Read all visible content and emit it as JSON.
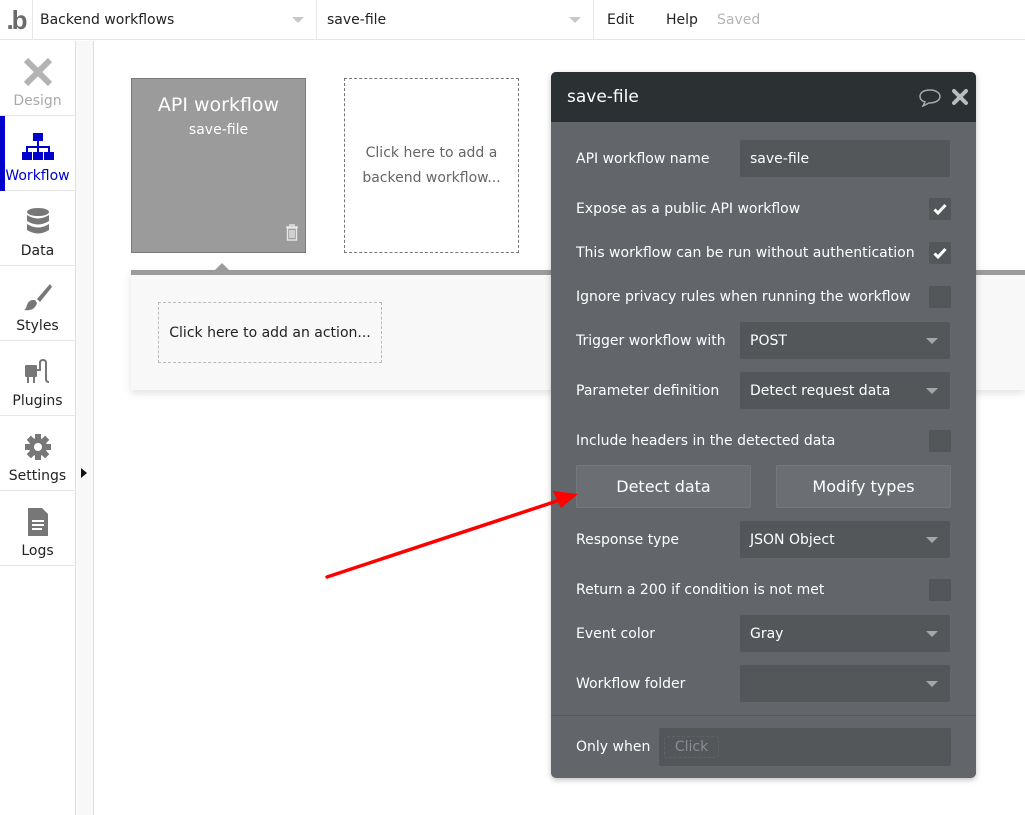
{
  "topbar": {
    "logo": ".b",
    "page_selector": "Backend workflows",
    "workflow_selector": "save-file",
    "menu_edit": "Edit",
    "menu_help": "Help",
    "save_status": "Saved"
  },
  "sidebar": {
    "items": [
      {
        "label": "Design",
        "icon": "design-icon",
        "state": "disabled"
      },
      {
        "label": "Workflow",
        "icon": "workflow-icon",
        "state": "active"
      },
      {
        "label": "Data",
        "icon": "database-icon",
        "state": "normal"
      },
      {
        "label": "Styles",
        "icon": "brush-icon",
        "state": "normal"
      },
      {
        "label": "Plugins",
        "icon": "plug-icon",
        "state": "normal"
      },
      {
        "label": "Settings",
        "icon": "gear-icon",
        "state": "normal"
      },
      {
        "label": "Logs",
        "icon": "document-icon",
        "state": "normal"
      }
    ]
  },
  "canvas": {
    "workflow_card": {
      "title": "API workflow",
      "name": "save-file"
    },
    "add_workflow": "Click here to add a backend workflow...",
    "add_action": "Click here to add an action..."
  },
  "property_editor": {
    "title": "save-file",
    "name_label": "API workflow name",
    "name_value": "save-file",
    "checkboxes": [
      {
        "label": "Expose as a public API workflow",
        "checked": true
      },
      {
        "label": "This workflow can be run without authentication",
        "checked": true
      },
      {
        "label": "Ignore privacy rules when running the workflow",
        "checked": false
      }
    ],
    "trigger_label": "Trigger workflow with",
    "trigger_value": "POST",
    "param_label": "Parameter definition",
    "param_value": "Detect request data",
    "headers_label": "Include headers in the detected data",
    "headers_checked": false,
    "detect_button": "Detect data",
    "modify_button": "Modify types",
    "response_label": "Response type",
    "response_value": "JSON Object",
    "return200_label": "Return a 200 if condition is not met",
    "return200_checked": false,
    "color_label": "Event color",
    "color_value": "Gray",
    "folder_label": "Workflow folder",
    "folder_value": "",
    "only_when_label": "Only when",
    "only_when_placeholder": "Click"
  },
  "annotation": {
    "color": "#ff0000"
  }
}
